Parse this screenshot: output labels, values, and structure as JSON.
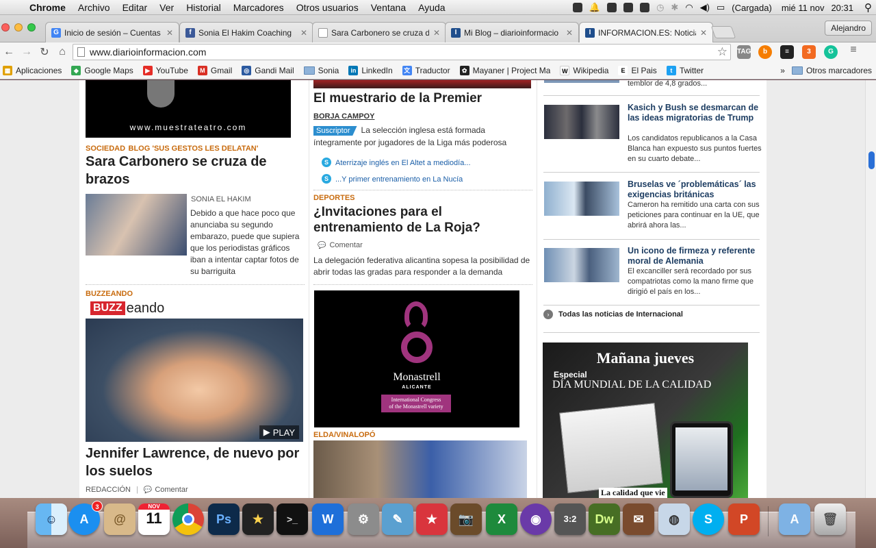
{
  "menubar": {
    "app": "Chrome",
    "items": [
      "Archivo",
      "Editar",
      "Ver",
      "Historial",
      "Marcadores",
      "Otros usuarios",
      "Ventana",
      "Ayuda"
    ],
    "battery": "(Cargada)",
    "date": "mié 11 nov",
    "time": "20:31"
  },
  "tabs": [
    {
      "title": "Inicio de sesión – Cuentas",
      "fav": "G",
      "color": "#4285f4"
    },
    {
      "title": "Sonia El Hakim Coaching",
      "fav": "f",
      "color": "#3b5998"
    },
    {
      "title": "Sara Carbonero se cruza de",
      "fav": "",
      "color": "#ffffff"
    },
    {
      "title": "Mi Blog – diarioinformacio",
      "fav": "I",
      "color": "#1f4e8c"
    },
    {
      "title": "INFORMACION.ES: Noticias",
      "fav": "I",
      "color": "#1f4e8c"
    }
  ],
  "user": "Alejandro",
  "url": "www.diarioinformacion.com",
  "bookmarks": [
    {
      "label": "Aplicaciones",
      "icon": "apps-icon",
      "color": "#e0a000"
    },
    {
      "label": "Google Maps",
      "icon": "maps-icon",
      "color": "#34a853"
    },
    {
      "label": "YouTube",
      "icon": "youtube-icon",
      "color": "#e52d27"
    },
    {
      "label": "Gmail",
      "icon": "gmail-icon",
      "color": "#d93025"
    },
    {
      "label": "Gandi Mail",
      "icon": "gandi-icon",
      "color": "#2c5aa0"
    },
    {
      "label": "Sonia",
      "icon": "folder-icon",
      "color": "#8fb3d9"
    },
    {
      "label": "LinkedIn",
      "icon": "linkedin-icon",
      "color": "#0077b5"
    },
    {
      "label": "Traductor",
      "icon": "translate-icon",
      "color": "#4285f4"
    },
    {
      "label": "Mayaner | Project Ma",
      "icon": "mayaner-icon",
      "color": "#222222"
    },
    {
      "label": "Wikipedia",
      "icon": "wikipedia-icon",
      "color": "#555555"
    },
    {
      "label": "El Pais",
      "icon": "elpais-icon",
      "color": "#111111"
    },
    {
      "label": "Twitter",
      "icon": "twitter-icon",
      "color": "#1da1f2"
    }
  ],
  "bookmarks_more": "»",
  "bookmarks_other": "Otros marcadores",
  "left": {
    "banner_text": "www.muestrateatro.com",
    "art1": {
      "kicker": "SOCIEDAD",
      "sub": "Blog 'Sus gestos les delatan'",
      "title": "Sara Carbonero se cruza de brazos",
      "author": "SONIA EL HAKIM",
      "body": "Debido a que hace poco que anunciaba su segundo embarazo, puede que supiera que los periodistas gráficos iban a intentar captar fotos de su barriguita"
    },
    "art2": {
      "kicker": "BUZZEANDO",
      "logo_a": "BUZZ",
      "logo_b": "eando",
      "play": "PLAY",
      "title": "Jennifer Lawrence, de nuevo por los suelos",
      "author": "REDACCIÓN",
      "comment": "Comentar"
    }
  },
  "middle": {
    "art1": {
      "title": "El muestrario de la Premier",
      "author": "BORJA CAMPOY",
      "badge": "Suscriptor",
      "body": "La selección inglesa está formada íntegramente por jugadores de la Liga más poderosa",
      "links": [
        "Aterrizaje inglés en El Altet a mediodía...",
        "...Y primer entrenamiento en La Nucía"
      ]
    },
    "art2": {
      "kicker": "DEPORTES",
      "title": "¿Invitaciones para el entrenamiento de La Roja?",
      "comment": "Comentar",
      "body": "La delegación federativa alicantina sopesa la posibilidad de abrir todas las gradas para responder a la demanda"
    },
    "ad": {
      "brand": "Monastrell",
      "city": "ALICANTE",
      "tag1": "International Congress",
      "tag2": "of the Monastrell variety"
    },
    "art3": {
      "kicker": "ELDA/VINALOPÓ"
    }
  },
  "right": {
    "top_snippet": "temblor de 4,8 grados...",
    "items": [
      {
        "title": "Kasich y Bush se desmarcan de las ideas migratorias de Trump",
        "body": "Los candidatos republicanos a la Casa Blanca han expuesto sus puntos fuertes en su cuarto debate..."
      },
      {
        "title": "Bruselas ve ´problemáticas´ las exigencias británicas",
        "body": "Cameron ha remitido una carta con sus peticiones para continuar en la UE, que abrirá ahora las..."
      },
      {
        "title": "Un icono de firmeza y referente moral de Alemania",
        "body": "El excanciller será recordado por sus compatriotas como la mano firme que dirigió el país en los..."
      }
    ],
    "all_news": "Todas las noticias de Internacional",
    "promo": {
      "headline": "Mañana jueves",
      "special": "Especial",
      "name": "DÍA MUNDIAL DE LA CALIDAD",
      "footer": "La calidad que vie"
    }
  },
  "dock": {
    "calendar_month": "NOV",
    "calendar_day": "11",
    "appstore_badge": "3"
  }
}
